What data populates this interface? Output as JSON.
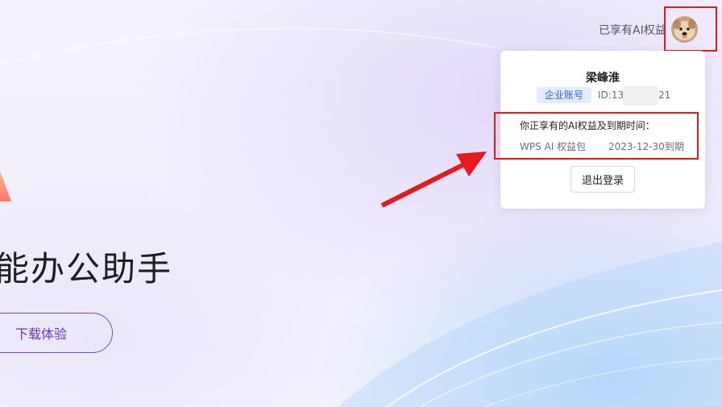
{
  "hero": {
    "title": "能办公助手",
    "download_label": "下载体验"
  },
  "header": {
    "ai_entitlement_label": "已享有AI权益",
    "avatar_icon": "dog-avatar-icon"
  },
  "account_popover": {
    "user_name": "梁峰淮",
    "account_type_badge": "企业账号",
    "id_prefix": "ID:13",
    "id_suffix": "21",
    "entitlement_heading": "你正享有的AI权益及到期时间：",
    "entitlements": [
      {
        "name": "WPS AI 权益包",
        "expiry": "2023-12-30到期"
      }
    ],
    "logout_label": "退出登录"
  },
  "colors": {
    "accent_purple": "#6b34d6",
    "badge_blue": "#2f66e6",
    "annotation_red": "#e8191b"
  }
}
